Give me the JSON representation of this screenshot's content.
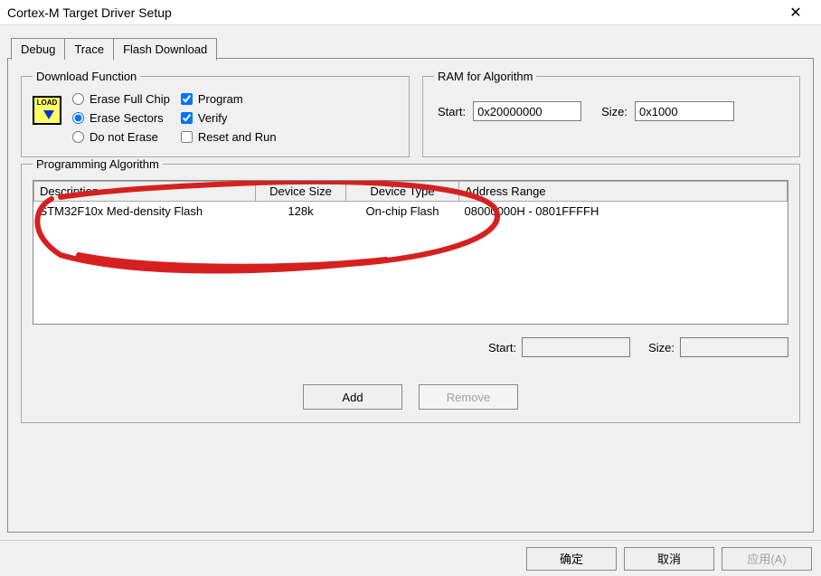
{
  "window": {
    "title": "Cortex-M Target Driver Setup"
  },
  "tabs": {
    "debug": "Debug",
    "trace": "Trace",
    "flash": "Flash Download"
  },
  "download_function": {
    "legend": "Download Function",
    "icon_text": "LOAD",
    "erase_full": "Erase Full Chip",
    "erase_sectors": "Erase Sectors",
    "do_not_erase": "Do not Erase",
    "program": "Program",
    "verify": "Verify",
    "reset_run": "Reset and Run"
  },
  "ram_algorithm": {
    "legend": "RAM for Algorithm",
    "start_label": "Start:",
    "start_value": "0x20000000",
    "size_label": "Size:",
    "size_value": "0x1000"
  },
  "programming_algorithm": {
    "legend": "Programming Algorithm",
    "headers": {
      "desc": "Description",
      "dsize": "Device Size",
      "dtype": "Device Type",
      "arange": "Address Range"
    },
    "row": {
      "desc": "STM32F10x Med-density Flash",
      "dsize": "128k",
      "dtype": "On-chip Flash",
      "arange": "08000000H - 0801FFFFH"
    },
    "start_label": "Start:",
    "size_label": "Size:",
    "add": "Add",
    "remove": "Remove"
  },
  "footer": {
    "ok": "确定",
    "cancel": "取消",
    "apply": "应用(A)"
  }
}
